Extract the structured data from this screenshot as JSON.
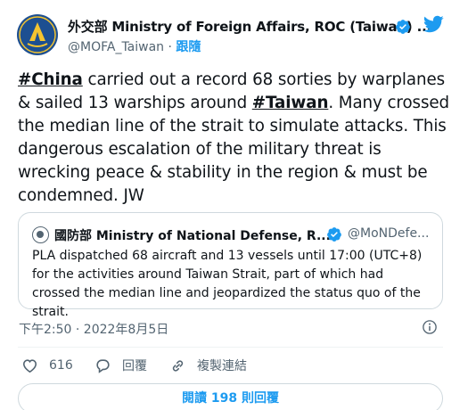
{
  "tweet": {
    "display_name": "外交部 Ministry of Foreign Affairs, ROC (Taiwan) ...",
    "handle": "@MOFA_Taiwan",
    "separator": "·",
    "follow_label": "跟隨",
    "text_parts": {
      "hashtag1": "#China",
      "segment1": " carried out a record 68 sorties by warplanes & sailed 13 warships around ",
      "hashtag2": "#Taiwan",
      "segment2": ". Many crossed the median line of the strait to simulate attacks. This dangerous escalation of the military threat is wrecking peace & stability in the region & must be condemned. JW"
    },
    "timestamp": "下午2:50 · 2022年8月5日"
  },
  "quote": {
    "display_name": "國防部 Ministry of National Defense, R....",
    "handle": "@MoNDefe...",
    "text": "PLA dispatched 68 aircraft and 13 vessels until 17:00 (UTC+8) for the activities around Taiwan Strait, part of which had crossed the median line and jeopardized the status quo of the strait."
  },
  "actions": {
    "like_count": "616",
    "reply_label": "回覆",
    "copy_link_label": "複製連結"
  },
  "read_replies": {
    "prefix": "閱讀 ",
    "count": "198",
    "suffix": " 則回覆"
  },
  "icons": {
    "verified": "verified-badge-icon",
    "brand": "twitter-bird-icon",
    "info": "info-icon",
    "like": "heart-icon",
    "reply": "speech-bubble-icon",
    "link": "link-icon"
  },
  "colors": {
    "accent": "#1d9bf0",
    "text": "#0f1419",
    "secondary_text": "#536471",
    "border": "#cfd9de"
  }
}
